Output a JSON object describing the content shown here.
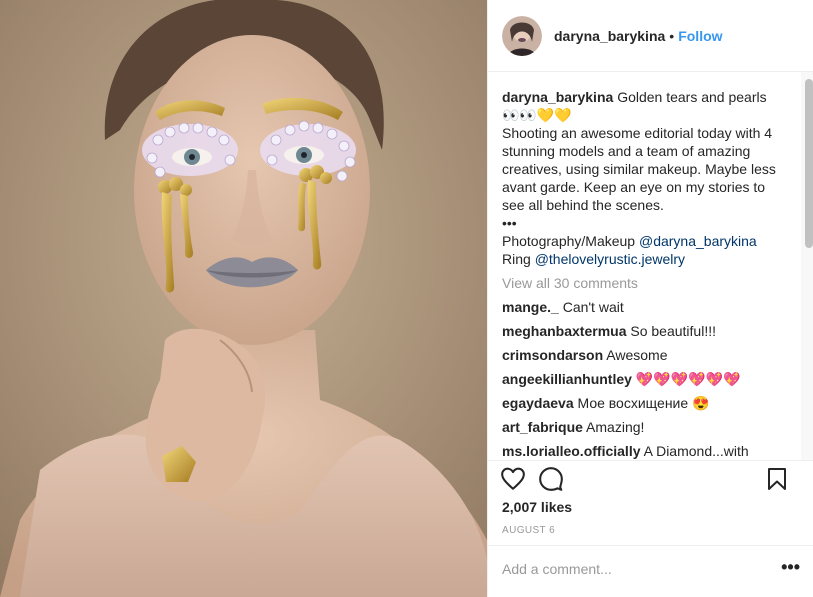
{
  "post": {
    "username": "daryna_barykina",
    "follow_label": "Follow",
    "separator": "•"
  },
  "caption": {
    "username": "daryna_barykina",
    "line1": "Golden tears and pearls 👀👀💛💛",
    "line2": "Shooting an awesome editorial today with 4 stunning models and a team of amazing creatives, using similar makeup. Maybe less avant garde. Keep an eye on my stories to see all behind the scenes.",
    "dots": "•••",
    "credit1_label": "Photography/Makeup ",
    "credit1_mention": "@daryna_barykina",
    "credit2_label": "Ring ",
    "credit2_mention": "@thelovelyrustic.jewelry"
  },
  "view_all": "View all 30 comments",
  "comments": [
    {
      "user": "mange._",
      "text": "Can't wait"
    },
    {
      "user": "meghanbaxtermua",
      "text": "So beautiful!!!"
    },
    {
      "user": "crimsondarson",
      "text": "Awesome"
    },
    {
      "user": "angeekillianhuntley",
      "text": "💖💖💖💖💖💖"
    },
    {
      "user": "egaydaeva",
      "text": "Мое восхищение 😍"
    },
    {
      "user": "art_fabrique",
      "text": "Amazing!"
    },
    {
      "user": "ms.lorialleo.officially",
      "text": "A Diamond...with"
    }
  ],
  "likes": "2,007 likes",
  "date": "AUGUST 6",
  "add_comment_placeholder": "Add a comment...",
  "more_label": "•••",
  "icons": {
    "like": "heart-icon",
    "comment": "comment-bubble-icon",
    "save": "bookmark-icon",
    "more": "more-options-icon"
  },
  "colors": {
    "follow": "#3897f0",
    "mention": "#003569",
    "muted": "#999999",
    "text": "#262626"
  }
}
